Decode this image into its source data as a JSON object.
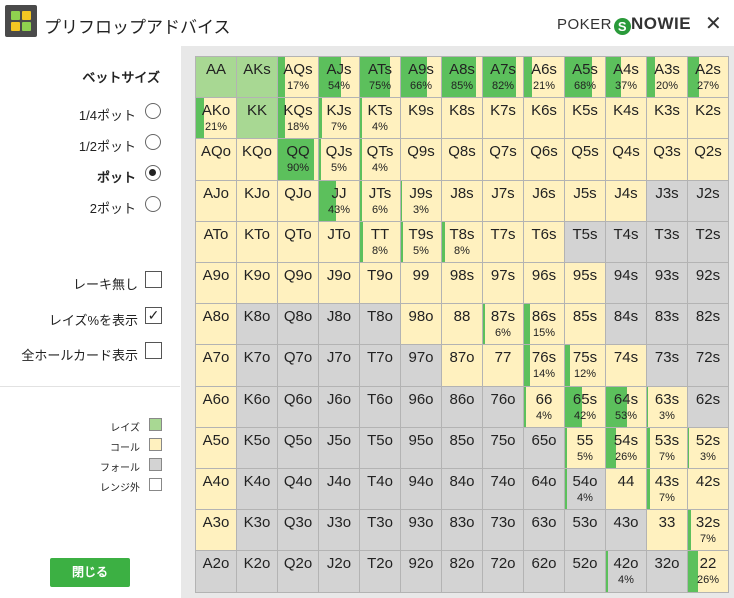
{
  "app": {
    "title": "プリフロップアドバイス",
    "brand_prefix": "POKER",
    "brand_s": "S",
    "brand_rest": "NOWIE",
    "close_symbol": "✕"
  },
  "colors": {
    "raise": "#a8d893",
    "call": "#fff1bf",
    "fold": "#d3d3d3",
    "raise_bar": "#5cc05c",
    "button": "#3cb043"
  },
  "bet_size": {
    "title": "ベットサイズ",
    "options": [
      {
        "label": "1/4ポット",
        "selected": false
      },
      {
        "label": "1/2ポット",
        "selected": false
      },
      {
        "label": "ポット",
        "selected": true
      },
      {
        "label": "2ポット",
        "selected": false
      }
    ]
  },
  "checkboxes": [
    {
      "label": "レーキ無し",
      "checked": false
    },
    {
      "label": "レイズ%を表示",
      "checked": true
    },
    {
      "label": "全ホールカード表示",
      "checked": false
    }
  ],
  "legend": [
    {
      "label": "レイズ",
      "type": "raise"
    },
    {
      "label": "コール",
      "type": "call"
    },
    {
      "label": "フォール",
      "type": "fold"
    },
    {
      "label": "レンジ外",
      "type": "none"
    }
  ],
  "close_button": "閉じる",
  "ranks": [
    "A",
    "K",
    "Q",
    "J",
    "T",
    "9",
    "8",
    "7",
    "6",
    "5",
    "4",
    "3",
    "2"
  ],
  "grid": [
    [
      [
        "R",
        ""
      ],
      [
        "R",
        ""
      ],
      [
        "C",
        "17%",
        17
      ],
      [
        "C",
        "54%",
        54
      ],
      [
        "C",
        "75%",
        75
      ],
      [
        "C",
        "66%",
        66
      ],
      [
        "C",
        "85%",
        85
      ],
      [
        "C",
        "82%",
        82
      ],
      [
        "C",
        "21%",
        21
      ],
      [
        "C",
        "68%",
        68
      ],
      [
        "C",
        "37%",
        37
      ],
      [
        "C",
        "20%",
        20
      ],
      [
        "C",
        "27%",
        27
      ]
    ],
    [
      [
        "C",
        "21%",
        21
      ],
      [
        "R",
        ""
      ],
      [
        "C",
        "18%",
        18
      ],
      [
        "C",
        "7%",
        7
      ],
      [
        "C",
        "4%",
        4
      ],
      [
        "C",
        ""
      ],
      [
        "C",
        ""
      ],
      [
        "C",
        ""
      ],
      [
        "C",
        ""
      ],
      [
        "C",
        ""
      ],
      [
        "C",
        ""
      ],
      [
        "C",
        ""
      ],
      [
        "C",
        ""
      ]
    ],
    [
      [
        "C",
        ""
      ],
      [
        "C",
        ""
      ],
      [
        "C",
        "90%",
        90
      ],
      [
        "C",
        "5%",
        5
      ],
      [
        "C",
        "4%",
        4
      ],
      [
        "C",
        ""
      ],
      [
        "C",
        ""
      ],
      [
        "C",
        ""
      ],
      [
        "C",
        ""
      ],
      [
        "C",
        ""
      ],
      [
        "C",
        ""
      ],
      [
        "C",
        ""
      ],
      [
        "C",
        ""
      ]
    ],
    [
      [
        "C",
        ""
      ],
      [
        "C",
        ""
      ],
      [
        "C",
        ""
      ],
      [
        "C",
        "43%",
        43
      ],
      [
        "C",
        "6%",
        6
      ],
      [
        "C",
        "3%",
        3
      ],
      [
        "C",
        ""
      ],
      [
        "C",
        ""
      ],
      [
        "C",
        ""
      ],
      [
        "C",
        ""
      ],
      [
        "C",
        ""
      ],
      [
        "F",
        ""
      ],
      [
        "F",
        ""
      ]
    ],
    [
      [
        "C",
        ""
      ],
      [
        "C",
        ""
      ],
      [
        "C",
        ""
      ],
      [
        "C",
        ""
      ],
      [
        "C",
        "8%",
        8
      ],
      [
        "C",
        "5%",
        5
      ],
      [
        "C",
        "8%",
        8
      ],
      [
        "C",
        ""
      ],
      [
        "C",
        ""
      ],
      [
        "F",
        ""
      ],
      [
        "F",
        ""
      ],
      [
        "F",
        ""
      ],
      [
        "F",
        ""
      ]
    ],
    [
      [
        "C",
        ""
      ],
      [
        "C",
        ""
      ],
      [
        "C",
        ""
      ],
      [
        "C",
        ""
      ],
      [
        "C",
        ""
      ],
      [
        "C",
        ""
      ],
      [
        "C",
        ""
      ],
      [
        "C",
        ""
      ],
      [
        "C",
        ""
      ],
      [
        "C",
        ""
      ],
      [
        "F",
        ""
      ],
      [
        "F",
        ""
      ],
      [
        "F",
        ""
      ]
    ],
    [
      [
        "C",
        ""
      ],
      [
        "F",
        ""
      ],
      [
        "F",
        ""
      ],
      [
        "F",
        ""
      ],
      [
        "F",
        ""
      ],
      [
        "C",
        ""
      ],
      [
        "C",
        ""
      ],
      [
        "C",
        "6%",
        6
      ],
      [
        "C",
        "15%",
        15
      ],
      [
        "C",
        ""
      ],
      [
        "F",
        ""
      ],
      [
        "F",
        ""
      ],
      [
        "F",
        ""
      ]
    ],
    [
      [
        "C",
        ""
      ],
      [
        "F",
        ""
      ],
      [
        "F",
        ""
      ],
      [
        "F",
        ""
      ],
      [
        "F",
        ""
      ],
      [
        "F",
        ""
      ],
      [
        "C",
        ""
      ],
      [
        "C",
        ""
      ],
      [
        "C",
        "14%",
        14
      ],
      [
        "C",
        "12%",
        12
      ],
      [
        "C",
        ""
      ],
      [
        "F",
        ""
      ],
      [
        "F",
        ""
      ]
    ],
    [
      [
        "C",
        ""
      ],
      [
        "F",
        ""
      ],
      [
        "F",
        ""
      ],
      [
        "F",
        ""
      ],
      [
        "F",
        ""
      ],
      [
        "F",
        ""
      ],
      [
        "F",
        ""
      ],
      [
        "F",
        ""
      ],
      [
        "C",
        "4%",
        4
      ],
      [
        "C",
        "42%",
        42
      ],
      [
        "C",
        "53%",
        53
      ],
      [
        "C",
        "3%",
        3
      ],
      [
        "F",
        ""
      ]
    ],
    [
      [
        "C",
        ""
      ],
      [
        "F",
        ""
      ],
      [
        "F",
        ""
      ],
      [
        "F",
        ""
      ],
      [
        "F",
        ""
      ],
      [
        "F",
        ""
      ],
      [
        "F",
        ""
      ],
      [
        "F",
        ""
      ],
      [
        "F",
        ""
      ],
      [
        "C",
        "5%",
        5
      ],
      [
        "C",
        "26%",
        26
      ],
      [
        "C",
        "7%",
        7
      ],
      [
        "C",
        "3%",
        3
      ]
    ],
    [
      [
        "C",
        ""
      ],
      [
        "F",
        ""
      ],
      [
        "F",
        ""
      ],
      [
        "F",
        ""
      ],
      [
        "F",
        ""
      ],
      [
        "F",
        ""
      ],
      [
        "F",
        ""
      ],
      [
        "F",
        ""
      ],
      [
        "F",
        ""
      ],
      [
        "F",
        "4%",
        4
      ],
      [
        "C",
        ""
      ],
      [
        "C",
        "7%",
        7
      ],
      [
        "C",
        ""
      ]
    ],
    [
      [
        "C",
        ""
      ],
      [
        "F",
        ""
      ],
      [
        "F",
        ""
      ],
      [
        "F",
        ""
      ],
      [
        "F",
        ""
      ],
      [
        "F",
        ""
      ],
      [
        "F",
        ""
      ],
      [
        "F",
        ""
      ],
      [
        "F",
        ""
      ],
      [
        "F",
        ""
      ],
      [
        "F",
        ""
      ],
      [
        "C",
        ""
      ],
      [
        "C",
        "7%",
        7
      ]
    ],
    [
      [
        "F",
        ""
      ],
      [
        "F",
        ""
      ],
      [
        "F",
        ""
      ],
      [
        "F",
        ""
      ],
      [
        "F",
        ""
      ],
      [
        "F",
        ""
      ],
      [
        "F",
        ""
      ],
      [
        "F",
        ""
      ],
      [
        "F",
        ""
      ],
      [
        "F",
        ""
      ],
      [
        "F",
        "4%",
        4
      ],
      [
        "F",
        ""
      ],
      [
        "C",
        "26%",
        26
      ]
    ]
  ]
}
